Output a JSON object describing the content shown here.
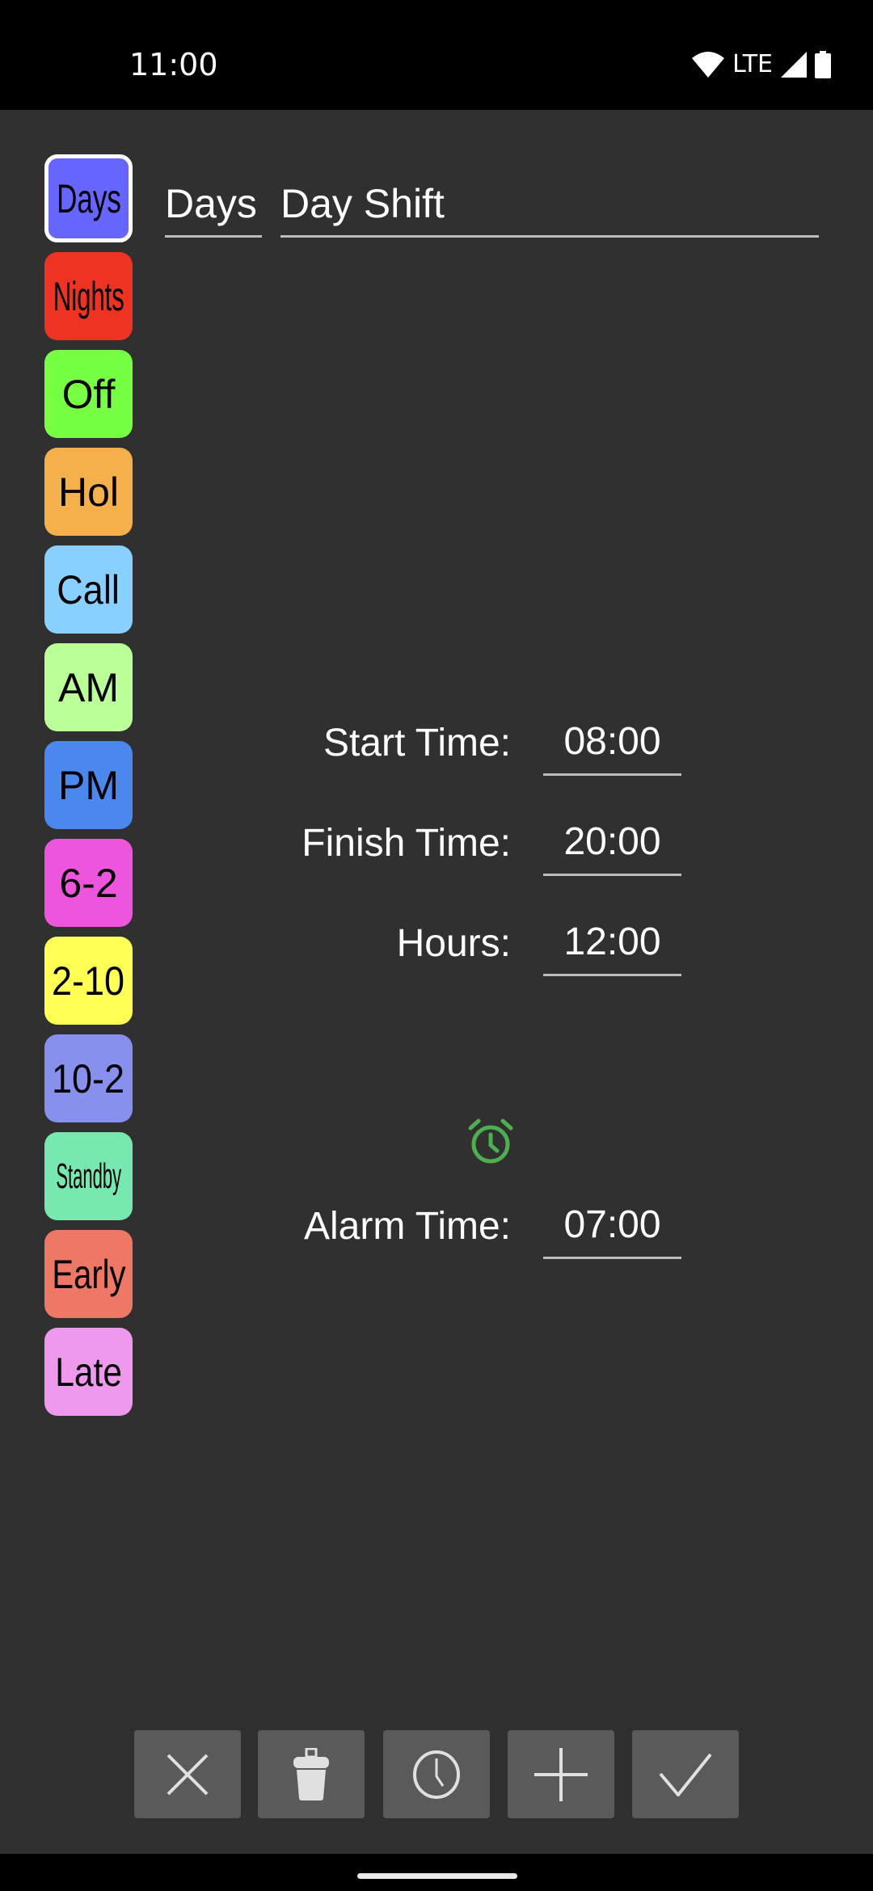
{
  "status_bar": {
    "time": "11:00",
    "network": "LTE",
    "icons": [
      "wifi-icon",
      "signal-icon",
      "battery-icon"
    ]
  },
  "shifts": [
    {
      "label": "Days",
      "color": "#6666ff",
      "selected": true
    },
    {
      "label": "Nights",
      "color": "#ee3322"
    },
    {
      "label": "Off",
      "color": "#77ff44"
    },
    {
      "label": "Hol",
      "color": "#f4b04a"
    },
    {
      "label": "Call",
      "color": "#88d0ff"
    },
    {
      "label": "AM",
      "color": "#bbff99"
    },
    {
      "label": "PM",
      "color": "#4a88f0"
    },
    {
      "label": "6-2",
      "color": "#ee55dd"
    },
    {
      "label": "2-10",
      "color": "#ffff55"
    },
    {
      "label": "10-2",
      "color": "#8890ee"
    },
    {
      "label": "Standby",
      "color": "#77e8b0"
    },
    {
      "label": "Early",
      "color": "#ee7766"
    },
    {
      "label": "Late",
      "color": "#ee99ee"
    }
  ],
  "editor": {
    "short_name": "Days",
    "full_name": "Day Shift",
    "start_label": "Start Time:",
    "start_value": "08:00",
    "finish_label": "Finish Time:",
    "finish_value": "20:00",
    "hours_label": "Hours:",
    "hours_value": "12:00",
    "alarm_label": "Alarm Time:",
    "alarm_value": "07:00",
    "alarm_icon_color": "#4caf50"
  },
  "toolbar": [
    "close-icon",
    "trash-icon",
    "clock-icon",
    "plus-icon",
    "check-icon"
  ]
}
